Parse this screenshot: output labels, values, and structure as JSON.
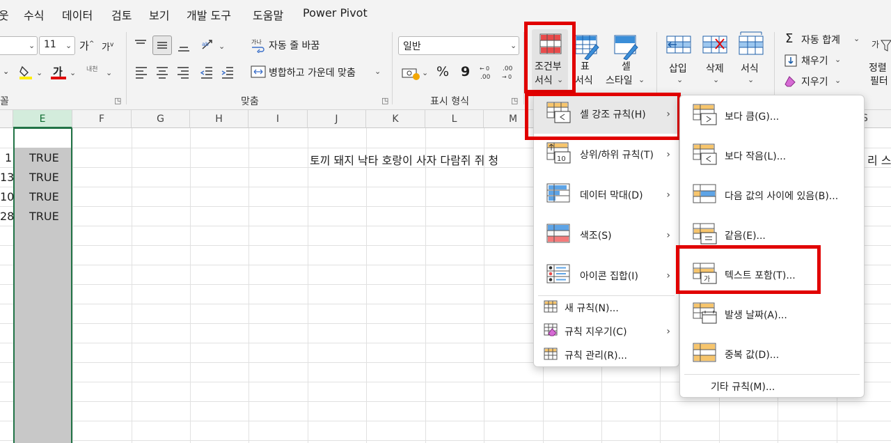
{
  "menubar": {
    "tabs": [
      "웃",
      "수식",
      "데이터",
      "검토",
      "보기",
      "개발 도구",
      "도움말",
      "Power Pivot"
    ]
  },
  "ribbon": {
    "font": {
      "size": "11",
      "group_label": "꼴",
      "grow": "가",
      "shrink": "가",
      "font_color_glyph": "가",
      "phonetic_glyph": "내천"
    },
    "align": {
      "wrap_label": "자동 줄 바꿈",
      "merge_label": "병합하고 가운데 맞춤",
      "group_label": "맞춤"
    },
    "number": {
      "format": "일반",
      "group_label": "표시 형식",
      "percent": "%",
      "comma": "9"
    },
    "styles": {
      "conditional_line1": "조건부",
      "conditional_line2": "서식",
      "table_line1": "표",
      "table_line2": "서식",
      "cell_line1": "셀",
      "cell_line2": "스타일"
    },
    "cells": {
      "insert": "삽입",
      "delete": "삭제",
      "format": "서식"
    },
    "editing": {
      "autosum": "자동 합계",
      "fill": "채우기",
      "clear": "지우기",
      "sort_line1": "정렬",
      "sort_line2": "필터"
    }
  },
  "sheet": {
    "columns": [
      "E",
      "F",
      "G",
      "H",
      "I",
      "J",
      "K",
      "L",
      "M"
    ],
    "columns_right": [
      "S"
    ],
    "row_stubs": [
      "1",
      "13",
      "10",
      "28"
    ],
    "e_values": [
      "TRUE",
      "TRUE",
      "TRUE",
      "TRUE"
    ],
    "j1_text": "토끼 돼지 낙타 호랑이 사자 다람쥐 쥐 청",
    "right_text": "리 스"
  },
  "menu_main": {
    "items": [
      {
        "label": "셀 강조 규칙(H)"
      },
      {
        "label": "상위/하위 규칙(T)"
      },
      {
        "label": "데이터 막대(D)"
      },
      {
        "label": "색조(S)"
      },
      {
        "label": "아이콘 집합(I)"
      }
    ],
    "small_items": [
      {
        "label": "새 규칙(N)..."
      },
      {
        "label": "규칙 지우기(C)"
      },
      {
        "label": "규칙 관리(R)..."
      }
    ]
  },
  "menu_sub": {
    "items": [
      {
        "label": "보다 큼(G)..."
      },
      {
        "label": "보다 작음(L)..."
      },
      {
        "label": "다음 값의 사이에 있음(B)..."
      },
      {
        "label": "같음(E)..."
      },
      {
        "label": "텍스트 포함(T)..."
      },
      {
        "label": "발생 날짜(A)..."
      },
      {
        "label": "중복 값(D)..."
      }
    ],
    "more": "기타 규칙(M)..."
  },
  "colors": {
    "accent_green": "#217346",
    "highlight_red": "#e10000",
    "selected_cell_fill": "#c8c8c8"
  }
}
